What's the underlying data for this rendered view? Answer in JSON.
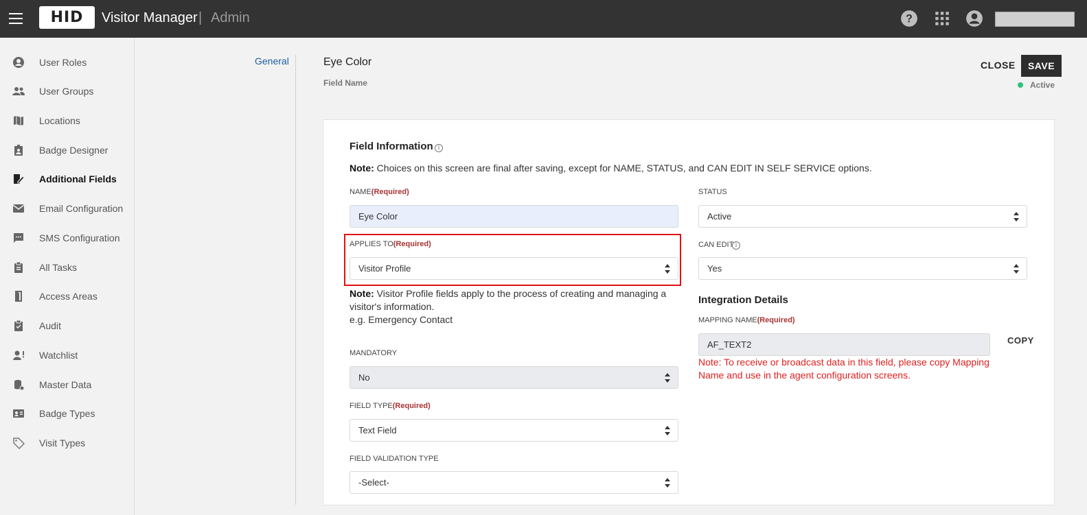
{
  "header": {
    "logo_text": "HID",
    "app_name": "Visitor Manager",
    "separator": "|",
    "section": "Admin",
    "icons": [
      "help-icon",
      "apps-grid-icon",
      "account-icon"
    ]
  },
  "sidebar": {
    "items": [
      {
        "label": "User Roles",
        "icon": "user-circle-icon"
      },
      {
        "label": "User Groups",
        "icon": "user-group-icon"
      },
      {
        "label": "Locations",
        "icon": "map-icon"
      },
      {
        "label": "Badge Designer",
        "icon": "badge-icon"
      },
      {
        "label": "Additional Fields",
        "icon": "edit-document-icon",
        "active": true
      },
      {
        "label": "Email Configuration",
        "icon": "mail-icon"
      },
      {
        "label": "SMS Configuration",
        "icon": "chat-icon"
      },
      {
        "label": "All Tasks",
        "icon": "clipboard-icon"
      },
      {
        "label": "Access Areas",
        "icon": "door-icon"
      },
      {
        "label": "Audit",
        "icon": "clipboard-check-icon"
      },
      {
        "label": "Watchlist",
        "icon": "person-alert-icon"
      },
      {
        "label": "Master Data",
        "icon": "database-icon"
      },
      {
        "label": "Badge Types",
        "icon": "id-card-icon"
      },
      {
        "label": "Visit Types",
        "icon": "tag-icon"
      }
    ]
  },
  "nav": {
    "general": "General"
  },
  "page": {
    "title": "Eye Color",
    "subtitle": "Field Name",
    "close_label": "CLOSE",
    "save_label": "SAVE",
    "status": "Active",
    "status_color": "#2ec27e"
  },
  "form": {
    "section_title": "Field Information",
    "note_label": "Note:",
    "note_text": "Choices on this screen are final after saving, except for NAME, STATUS, and CAN EDIT IN SELF SERVICE options.",
    "required": "(Required)",
    "name": {
      "label": "NAME",
      "value": "Eye Color"
    },
    "applies_to": {
      "label": "APPLIES TO",
      "value": "Visitor Profile"
    },
    "applies_note_label": "Note:",
    "applies_note_text": "Visitor Profile fields apply to the process of creating and managing a visitor's information.",
    "applies_note_example": "e.g. Emergency Contact",
    "mandatory": {
      "label": "MANDATORY",
      "value": "No"
    },
    "field_type": {
      "label": "FIELD TYPE",
      "value": "Text Field"
    },
    "validation_type": {
      "label": "FIELD VALIDATION TYPE",
      "value": "-Select-"
    },
    "status": {
      "label": "STATUS",
      "value": "Active"
    },
    "can_edit": {
      "label": "CAN EDIT",
      "value": "Yes"
    },
    "integration_title": "Integration Details",
    "mapping_name": {
      "label": "MAPPING NAME",
      "value": "AF_TEXT2"
    },
    "copy_label": "COPY",
    "mapping_note": "Note: To receive or broadcast data in this field, please copy Mapping Name and use in the agent configuration screens.",
    "highlight_color": "#e01010"
  }
}
